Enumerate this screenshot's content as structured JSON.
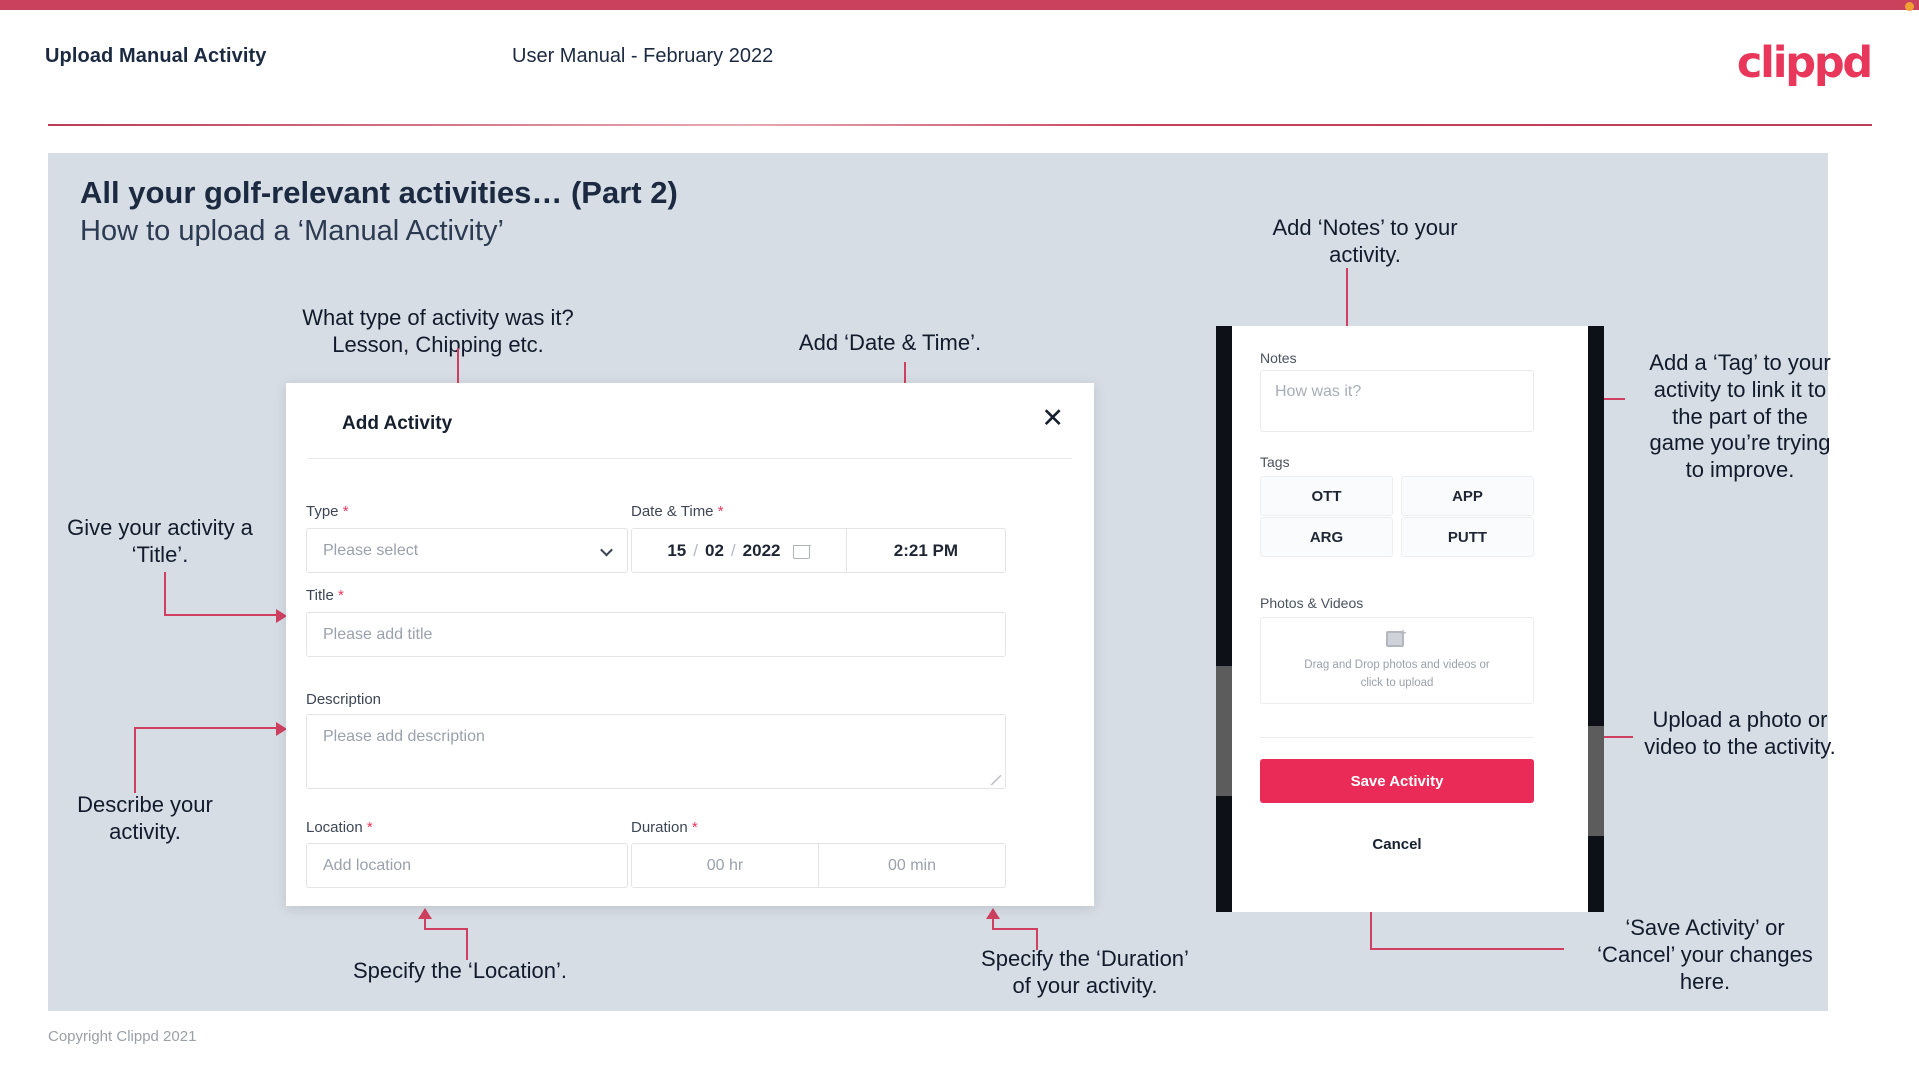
{
  "header": {
    "title": "Upload Manual Activity",
    "subtitle": "User Manual - February 2022",
    "logo": "clippd"
  },
  "slide": {
    "heading": "All your golf-relevant activities… (Part 2)",
    "subheading": "How to upload a ‘Manual Activity’"
  },
  "annotations": {
    "type": "What type of activity was it?\nLesson, Chipping etc.",
    "datetime": "Add ‘Date & Time’.",
    "notes": "Add ‘Notes’ to your\nactivity.",
    "tag": "Add a ‘Tag’ to your\nactivity to link it to\nthe part of the\ngame you’re trying\nto improve.",
    "title": "Give your activity a\n‘Title’.",
    "describe": "Describe your\nactivity.",
    "location": "Specify the ‘Location’.",
    "duration": "Specify the ‘Duration’\nof your activity.",
    "upload": "Upload a photo or\nvideo to the activity.",
    "save_cancel": "‘Save Activity’ or\n‘Cancel’ your changes\nhere."
  },
  "dialog": {
    "title": "Add Activity",
    "close_icon": "✕",
    "fields": {
      "type": {
        "label": "Type",
        "required": "*",
        "placeholder": "Please select"
      },
      "datetime": {
        "label": "Date & Time",
        "required": "*",
        "day": "15",
        "sep1": "/",
        "month": "02",
        "sep2": "/",
        "year": "2022",
        "time": "2:21 PM"
      },
      "title": {
        "label": "Title",
        "required": "*",
        "placeholder": "Please add title"
      },
      "description": {
        "label": "Description",
        "placeholder": "Please add description"
      },
      "location": {
        "label": "Location",
        "required": "*",
        "placeholder": "Add location"
      },
      "duration": {
        "label": "Duration",
        "required": "*",
        "hours": "00 hr",
        "minutes": "00 min"
      }
    }
  },
  "phone": {
    "notes": {
      "label": "Notes",
      "placeholder": "How was it?"
    },
    "tags": {
      "label": "Tags",
      "items": [
        "OTT",
        "APP",
        "ARG",
        "PUTT"
      ]
    },
    "photos": {
      "label": "Photos & Videos",
      "drop_line1": "Drag and Drop photos and videos or",
      "drop_line2": "click to upload",
      "icon_plus": "+"
    },
    "save_label": "Save Activity",
    "cancel_label": "Cancel"
  },
  "footer": {
    "copyright": "Copyright Clippd 2021"
  },
  "colors": {
    "brand_pink": "#e8375a",
    "accent_rose": "#c9415c",
    "arrow": "#cf4060",
    "slide_bg": "#d7dde5",
    "ink": "#1b2a41",
    "save_button": "#ea2b57"
  }
}
